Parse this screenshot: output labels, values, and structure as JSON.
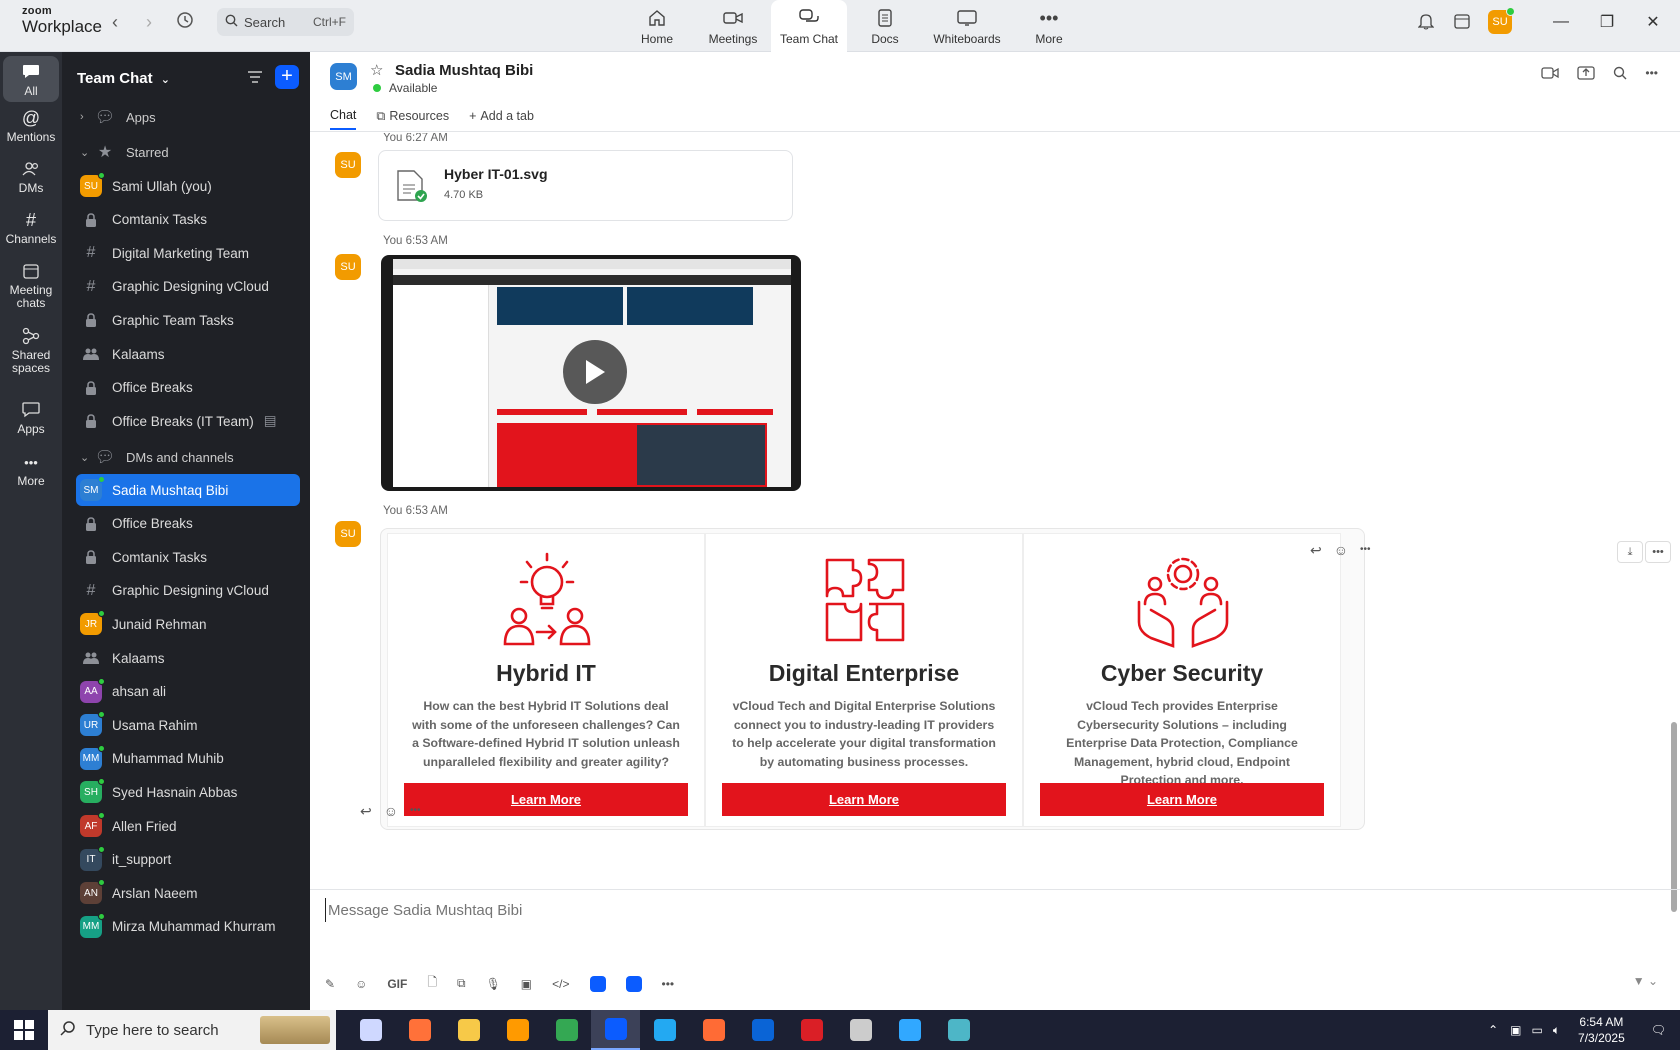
{
  "app": {
    "logo_line1": "zoom",
    "logo_line2": "Workplace"
  },
  "search": {
    "placeholder": "Search",
    "shortcut": "Ctrl+F"
  },
  "nav_tabs": [
    {
      "label": "Home",
      "icon": "home-icon"
    },
    {
      "label": "Meetings",
      "icon": "video-camera-icon"
    },
    {
      "label": "Team Chat",
      "icon": "chat-bubbles-icon",
      "active": true
    },
    {
      "label": "Docs",
      "icon": "document-icon"
    },
    {
      "label": "Whiteboards",
      "icon": "whiteboard-icon"
    },
    {
      "label": "More",
      "icon": "ellipsis-icon"
    }
  ],
  "user": {
    "initials": "SU",
    "status": "online"
  },
  "rail": [
    {
      "label": "All",
      "icon": "chat-icon",
      "active": true
    },
    {
      "label": "Mentions",
      "icon": "at-sign-icon"
    },
    {
      "label": "DMs",
      "icon": "people-icon"
    },
    {
      "label": "Channels",
      "icon": "hash-icon"
    },
    {
      "label": "Meeting chats",
      "icon": "calendar-icon"
    },
    {
      "label": "Shared spaces",
      "icon": "branch-icon"
    },
    {
      "label": "Apps",
      "icon": "apps-bubble-icon"
    },
    {
      "label": "More",
      "icon": "more-dots-icon"
    }
  ],
  "sidebar": {
    "title": "Team Chat",
    "sections": {
      "apps": "Apps",
      "starred": "Starred",
      "dms_channels": "DMs and channels"
    },
    "starred": [
      {
        "label": "Sami Ullah (you)",
        "type": "avatar",
        "initials": "SU",
        "color": "#f29b00",
        "online": true
      },
      {
        "label": "Comtanix Tasks",
        "type": "lock"
      },
      {
        "label": "Digital Marketing Team",
        "type": "hash"
      },
      {
        "label": "Graphic Designing vCloud",
        "type": "hash"
      },
      {
        "label": "Graphic Team Tasks",
        "type": "lock"
      },
      {
        "label": "Kalaams",
        "type": "group"
      },
      {
        "label": "Office Breaks",
        "type": "lock"
      },
      {
        "label": "Office Breaks (IT Team)",
        "type": "lock"
      }
    ],
    "dms": [
      {
        "label": "Sadia Mushtaq Bibi",
        "type": "avatar",
        "initials": "SM",
        "color": "#2d7fd3",
        "online": true,
        "selected": true
      },
      {
        "label": "Office Breaks",
        "type": "lock"
      },
      {
        "label": "Comtanix Tasks",
        "type": "lock"
      },
      {
        "label": "Graphic Designing vCloud",
        "type": "hash"
      },
      {
        "label": "Junaid Rehman",
        "type": "avatar",
        "initials": "JR",
        "color": "#f29b00",
        "online": true
      },
      {
        "label": "Kalaams",
        "type": "group"
      },
      {
        "label": "ahsan ali",
        "type": "avatar",
        "initials": "AA",
        "color": "#8e44ad",
        "online": true
      },
      {
        "label": "Usama Rahim",
        "type": "avatar",
        "initials": "UR",
        "color": "#2d7fd3",
        "online": true
      },
      {
        "label": "Muhammad Muhib",
        "type": "avatar",
        "initials": "MM",
        "color": "#2d7fd3",
        "online": true
      },
      {
        "label": "Syed Hasnain Abbas",
        "type": "avatar",
        "initials": "SH",
        "color": "#27ae60",
        "online": true
      },
      {
        "label": "Allen Fried",
        "type": "avatar",
        "initials": "AF",
        "color": "#c0392b",
        "online": true
      },
      {
        "label": "it_support",
        "type": "avatar",
        "initials": "IT",
        "color": "#34495e",
        "online": true
      },
      {
        "label": "Arslan Naeem",
        "type": "avatar",
        "initials": "AN",
        "color": "#5d4037",
        "online": true
      },
      {
        "label": "Mirza Muhammad Khurram",
        "type": "avatar",
        "initials": "MM",
        "color": "#16a085",
        "online": true
      }
    ]
  },
  "chat": {
    "contact": {
      "name": "Sadia Mushtaq Bibi",
      "initials": "SM",
      "status": "Available"
    },
    "tabs": [
      "Chat",
      "Resources",
      "Add a tab"
    ],
    "messages": [
      {
        "sender": "SU",
        "meta": "You 6:27 AM",
        "kind": "file",
        "file_name": "Hyber IT-01.svg",
        "file_size": "4.70 KB"
      },
      {
        "sender": "SU",
        "meta": "You 6:53 AM",
        "kind": "video"
      },
      {
        "sender": "SU",
        "meta": "You 6:53 AM",
        "kind": "image"
      }
    ],
    "cards": [
      {
        "title": "Hybrid IT",
        "desc": "How can the best Hybrid IT Solutions deal with some of the unforeseen challenges? Can a Software-defined Hybrid IT solution unleash unparalleled flexibility and greater agility?",
        "button": "Learn More"
      },
      {
        "title": "Digital Enterprise",
        "desc": "vCloud Tech and Digital Enterprise Solutions connect you to industry-leading IT providers to help accelerate your digital transformation by automating business processes.",
        "button": "Learn More"
      },
      {
        "title": "Cyber Security",
        "desc": "vCloud Tech provides Enterprise Cybersecurity Solutions – including Enterprise Data Protection, Compliance Management, hybrid cloud, Endpoint Protection and more.",
        "button": "Learn More"
      }
    ],
    "composer_placeholder": "Message Sadia Mushtaq Bibi",
    "composer_tools": {
      "gif": "GIF"
    }
  },
  "taskbar": {
    "search_placeholder": "Type here to search",
    "time": "6:54 AM",
    "date": "7/3/2025",
    "apps": [
      {
        "name": "task-view",
        "color": "#cfd8ff"
      },
      {
        "name": "firefox",
        "color": "#ff7139"
      },
      {
        "name": "file-explorer",
        "color": "#f7c948"
      },
      {
        "name": "illustrator",
        "color": "#ff9a00"
      },
      {
        "name": "chrome",
        "color": "#34a853"
      },
      {
        "name": "zoom",
        "color": "#0b5cff",
        "active": true
      },
      {
        "name": "vscode",
        "color": "#23a9f2"
      },
      {
        "name": "app-orange",
        "color": "#ff6b35"
      },
      {
        "name": "outlook",
        "color": "#0a64d6"
      },
      {
        "name": "creative-cloud",
        "color": "#da1f26"
      },
      {
        "name": "pen-tool",
        "color": "#cccccc"
      },
      {
        "name": "photoshop",
        "color": "#31a8ff"
      },
      {
        "name": "app-teal",
        "color": "#4db6c7"
      }
    ]
  },
  "colors": {
    "accent": "#0b5cff",
    "brand_red": "#e2141c",
    "sidebar_bg": "#1f2126",
    "rail_bg": "#2c2f36"
  }
}
